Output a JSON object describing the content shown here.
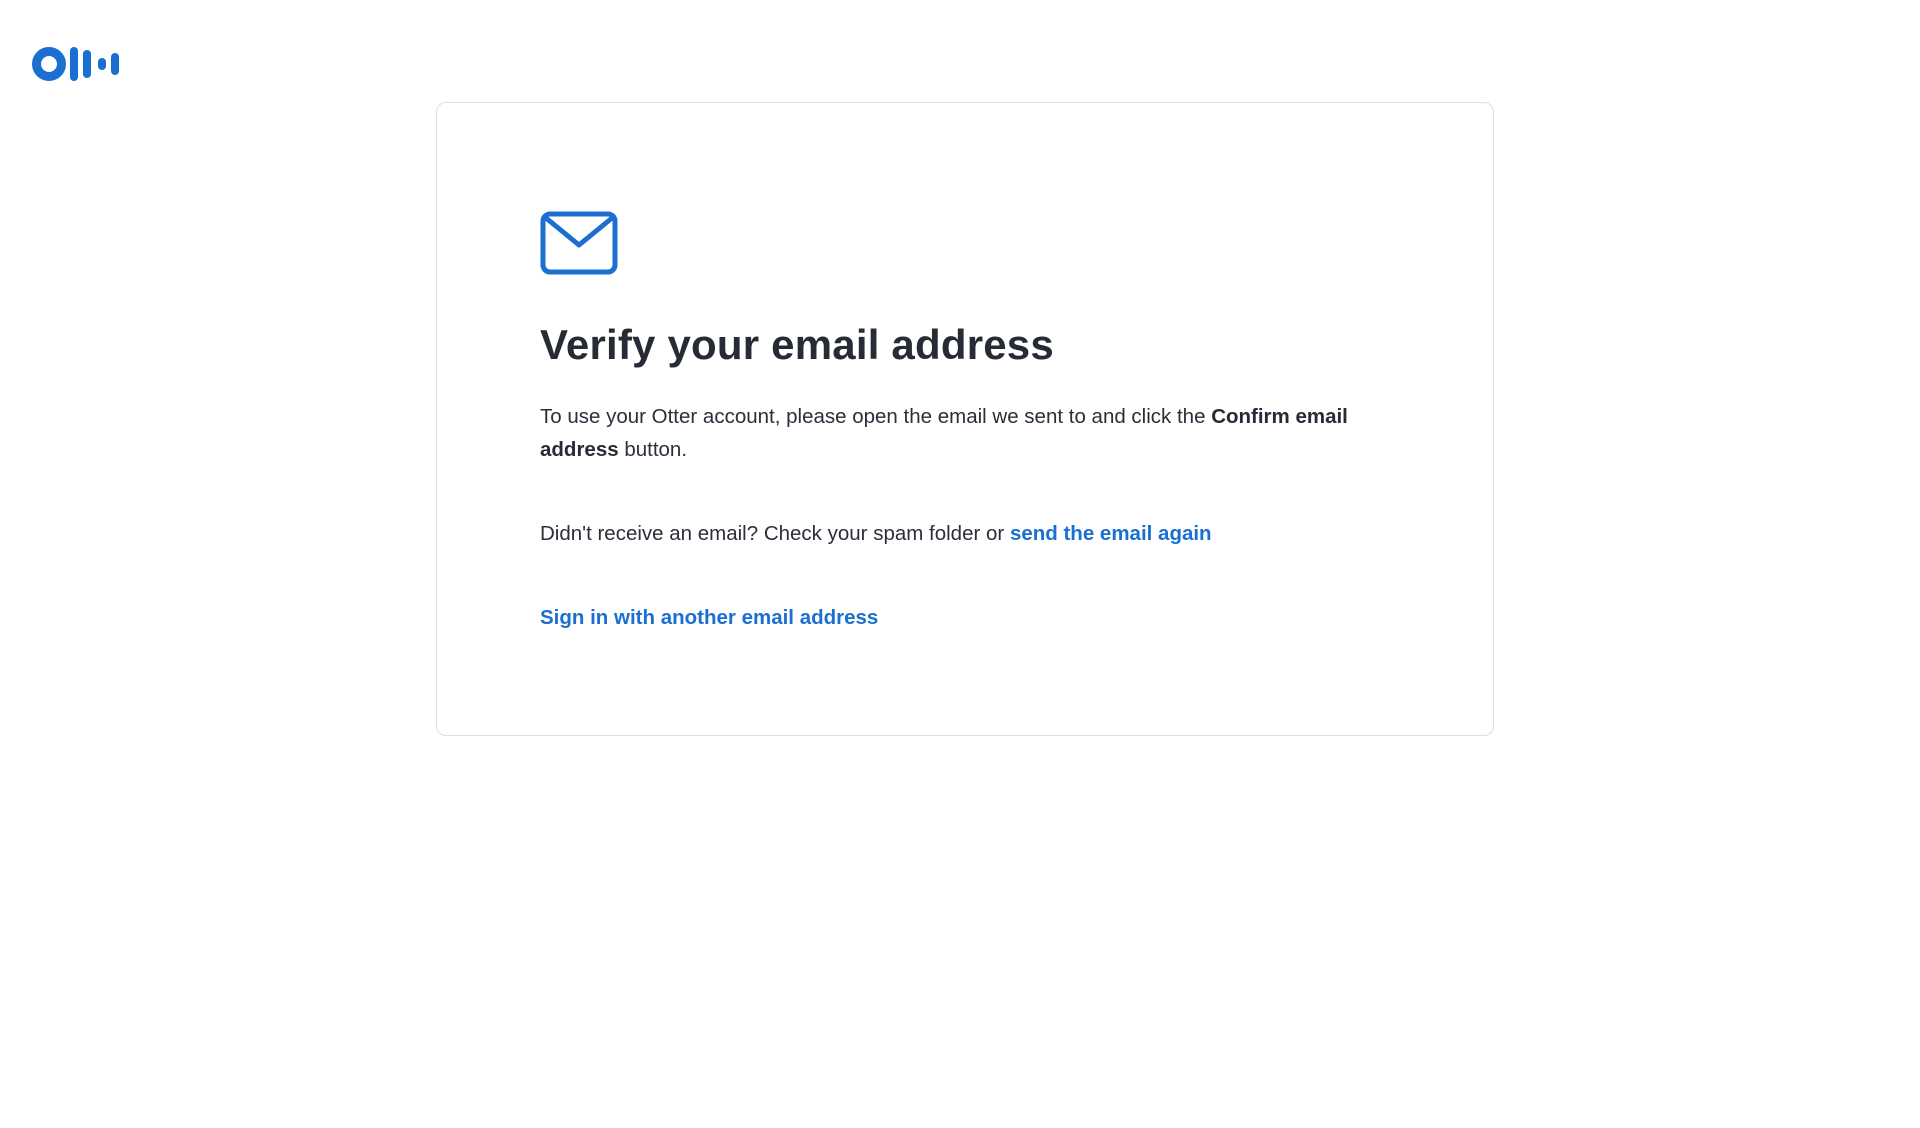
{
  "brand": {
    "logo_icon": "otter-logo-icon",
    "color": "#1a6fd0"
  },
  "card": {
    "icon": "envelope-icon",
    "title": "Verify your email address",
    "description": {
      "before": "To use your Otter account, please open the email we sent to and click the ",
      "bold": "Confirm email address",
      "after": " button."
    },
    "resend": {
      "prefix": "Didn't receive an email? Check your spam folder or ",
      "link_label": "send the email again"
    },
    "signin_link_label": "Sign in with another email address"
  },
  "colors": {
    "accent": "#1a6fd0",
    "text": "#2b2f3a",
    "border": "#dcdfe4"
  }
}
